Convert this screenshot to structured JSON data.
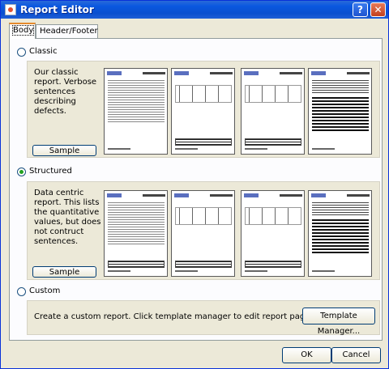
{
  "window": {
    "title": "Report Editor",
    "help_glyph": "?",
    "close_glyph": "✕"
  },
  "tabs": [
    {
      "label": "Body"
    },
    {
      "label": "Header/Footer"
    }
  ],
  "options": {
    "classic": {
      "label": "Classic",
      "description": "Our classic report. Verbose sentences describing defects.",
      "sample_label": "Sample"
    },
    "structured": {
      "label": "Structured",
      "description": "Data centric report. This lists the quantitative values, but does not contruct sentences.",
      "sample_label": "Sample"
    },
    "custom": {
      "label": "Custom",
      "description": "Create a custom report. Click template manager to edit report pages.",
      "manager_label": "Template Manager..."
    }
  },
  "selected_option": "structured",
  "footer": {
    "ok_label": "OK",
    "cancel_label": "Cancel"
  }
}
